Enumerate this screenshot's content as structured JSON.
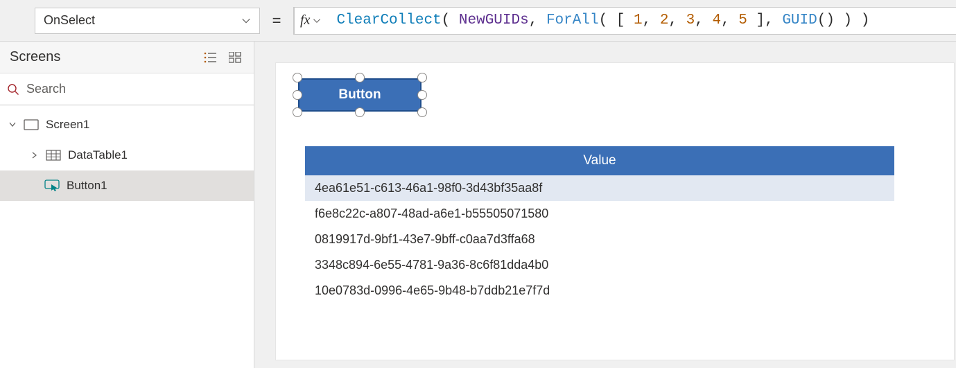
{
  "formula_bar": {
    "property": "OnSelect",
    "equals": "=",
    "fx_label": "fx",
    "formula_tokens": [
      {
        "t": "func",
        "v": "ClearCollect"
      },
      {
        "t": "plain",
        "v": "( "
      },
      {
        "t": "ident",
        "v": "NewGUIDs"
      },
      {
        "t": "plain",
        "v": ", "
      },
      {
        "t": "func2",
        "v": "ForAll"
      },
      {
        "t": "plain",
        "v": "( [ "
      },
      {
        "t": "num",
        "v": "1"
      },
      {
        "t": "plain",
        "v": ", "
      },
      {
        "t": "num",
        "v": "2"
      },
      {
        "t": "plain",
        "v": ", "
      },
      {
        "t": "num",
        "v": "3"
      },
      {
        "t": "plain",
        "v": ", "
      },
      {
        "t": "num",
        "v": "4"
      },
      {
        "t": "plain",
        "v": ", "
      },
      {
        "t": "num",
        "v": "5"
      },
      {
        "t": "plain",
        "v": " ], "
      },
      {
        "t": "func2",
        "v": "GUID"
      },
      {
        "t": "plain",
        "v": "() ) )"
      }
    ]
  },
  "left_panel": {
    "title": "Screens",
    "search_placeholder": "Search",
    "tree": {
      "screen": "Screen1",
      "datatable": "DataTable1",
      "button": "Button1"
    }
  },
  "canvas": {
    "button_label": "Button",
    "table": {
      "header": "Value",
      "rows": [
        "4ea61e51-c613-46a1-98f0-3d43bf35aa8f",
        "f6e8c22c-a807-48ad-a6e1-b55505071580",
        "0819917d-9bf1-43e7-9bff-c0aa7d3ffa68",
        "3348c894-6e55-4781-9a36-8c6f81dda4b0",
        "10e0783d-0996-4e65-9b48-b7ddb21e7f7d"
      ]
    }
  }
}
